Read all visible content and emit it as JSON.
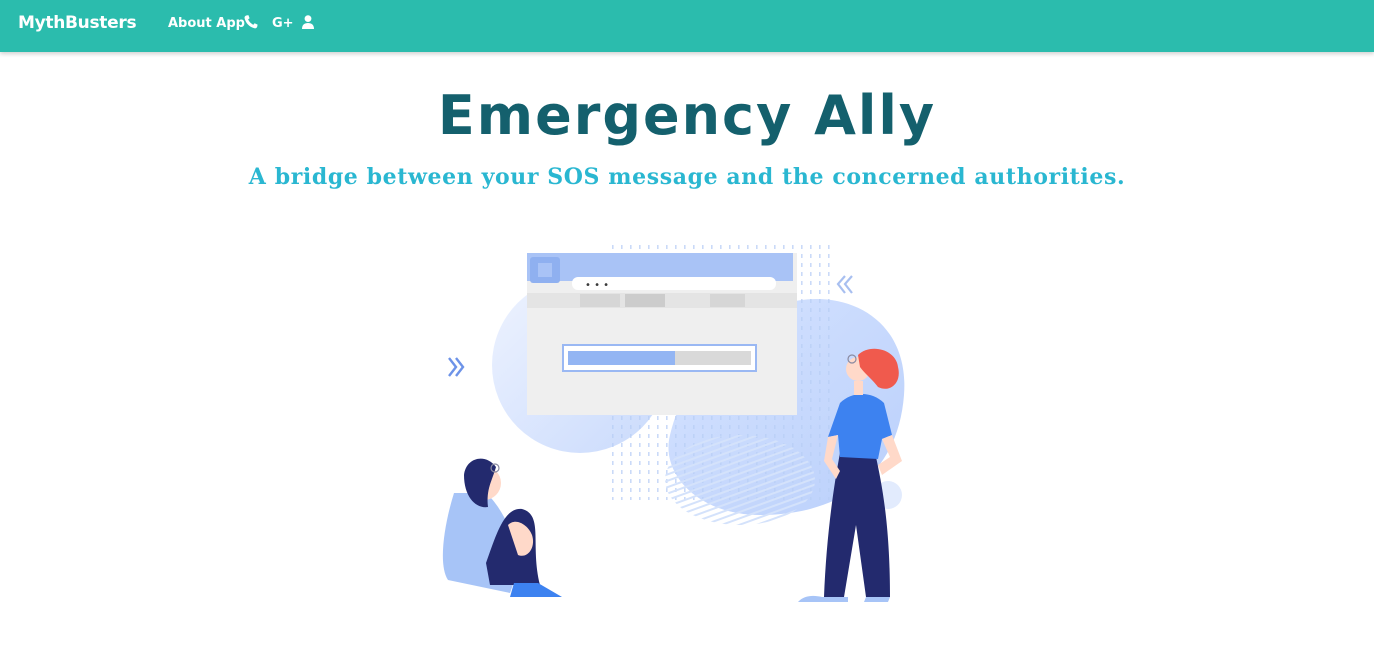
{
  "navbar": {
    "brand": "MythBusters",
    "about_label": "About App",
    "phone_icon": "phone-icon",
    "google_plus_label": "G+",
    "user_icon": "user-icon",
    "background": "#2bbcad"
  },
  "hero": {
    "title": "Emergency Ally",
    "subtitle": "A bridge between your SOS message and the concerned authorities.",
    "title_color": "#14606d",
    "subtitle_color": "#2ab7d1"
  },
  "illustration": {
    "window_dots": "• • •",
    "icons": [
      "chevron-right-double-icon",
      "chevron-left-double-icon"
    ]
  }
}
